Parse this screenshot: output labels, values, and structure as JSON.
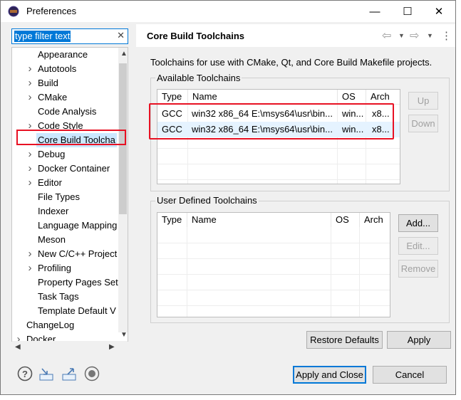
{
  "window": {
    "title": "Preferences",
    "minimize": "—",
    "maximize": "☐",
    "close": "✕"
  },
  "filter": {
    "value": "type filter text",
    "clear_icon": "✕"
  },
  "tree": {
    "items": [
      {
        "label": "Appearance",
        "expandable": false
      },
      {
        "label": "Autotools",
        "expandable": true
      },
      {
        "label": "Build",
        "expandable": true
      },
      {
        "label": "CMake",
        "expandable": true
      },
      {
        "label": "Code Analysis",
        "expandable": false
      },
      {
        "label": "Code Style",
        "expandable": true
      },
      {
        "label": "Core Build Toolcha",
        "expandable": false,
        "selected": true
      },
      {
        "label": "Debug",
        "expandable": true
      },
      {
        "label": "Docker Container",
        "expandable": true
      },
      {
        "label": "Editor",
        "expandable": true
      },
      {
        "label": "File Types",
        "expandable": false
      },
      {
        "label": "Indexer",
        "expandable": false
      },
      {
        "label": "Language Mapping",
        "expandable": false
      },
      {
        "label": "Meson",
        "expandable": false
      },
      {
        "label": "New C/C++ Project",
        "expandable": true
      },
      {
        "label": "Profiling",
        "expandable": true
      },
      {
        "label": "Property Pages Set",
        "expandable": false
      },
      {
        "label": "Task Tags",
        "expandable": false
      },
      {
        "label": "Template Default V",
        "expandable": false
      },
      {
        "label": "ChangeLog",
        "expandable": false,
        "level": 0
      },
      {
        "label": "Docker",
        "expandable": true,
        "level": 0
      }
    ]
  },
  "page": {
    "title": "Core Build Toolchains",
    "description": "Toolchains for use with CMake, Qt, and Core Build Makefile projects.",
    "nav": {
      "back": "⇦",
      "forward": "⇨",
      "menu": "⋮"
    }
  },
  "available": {
    "label": "Available Toolchains",
    "columns": [
      "Type",
      "Name",
      "OS",
      "Arch"
    ],
    "rows": [
      {
        "type": "GCC",
        "name": "win32 x86_64 E:\\msys64\\usr\\bin...",
        "os": "win...",
        "arch": "x8..."
      },
      {
        "type": "GCC",
        "name": "win32 x86_64 E:\\msys64\\usr\\bin...",
        "os": "win...",
        "arch": "x8..."
      }
    ],
    "up": "Up",
    "down": "Down"
  },
  "user_defined": {
    "label": "User Defined Toolchains",
    "columns": [
      "Type",
      "Name",
      "OS",
      "Arch"
    ],
    "add": "Add...",
    "edit": "Edit...",
    "remove": "Remove"
  },
  "buttons": {
    "restore_defaults": "Restore Defaults",
    "apply": "Apply",
    "apply_and_close": "Apply and Close",
    "cancel": "Cancel"
  },
  "colors": {
    "highlight_red": "#e81123",
    "selection_blue": "#0078d7"
  }
}
